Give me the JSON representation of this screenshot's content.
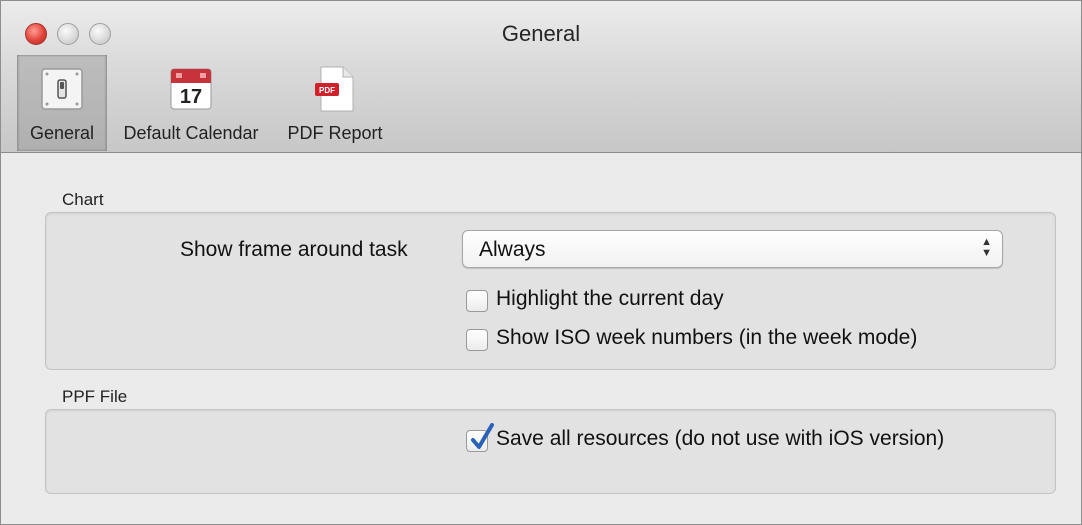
{
  "window": {
    "title": "General"
  },
  "toolbar": {
    "items": [
      {
        "label": "General",
        "icon": "switch-icon",
        "selected": true
      },
      {
        "label": "Default Calendar",
        "icon": "calendar-icon",
        "calendar_day": "17"
      },
      {
        "label": "PDF Report",
        "icon": "pdf-document-icon",
        "badge": "PDF"
      }
    ]
  },
  "chart_group": {
    "label": "Chart",
    "frame_label": "Show frame around task",
    "frame_value": "Always",
    "highlight_label": "Highlight the current day",
    "highlight_checked": false,
    "iso_label": "Show ISO week numbers (in the week mode)",
    "iso_checked": false
  },
  "ppf_group": {
    "label": "PPF File",
    "save_label": "Save all resources (do not use with iOS version)",
    "save_checked": true
  },
  "colors": {
    "close_button": "#e0443a",
    "checkmark": "#2a62b8",
    "pdf_badge": "#d0202a",
    "calendar_header": "#c8323a"
  }
}
